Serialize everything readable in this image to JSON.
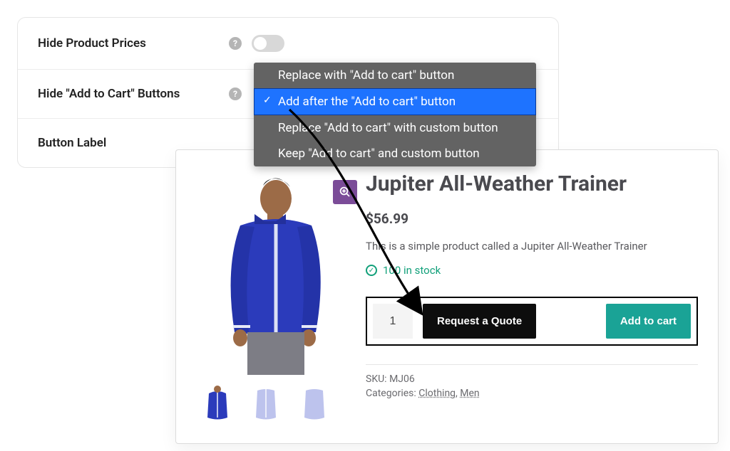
{
  "settings": {
    "row1": {
      "label": "Hide Product Prices"
    },
    "row2": {
      "label": "Hide \"Add to Cart\" Buttons"
    },
    "row3": {
      "label": "Button Label"
    }
  },
  "dropdown": {
    "options": [
      {
        "label": "Replace with \"Add to cart\" button"
      },
      {
        "label": "Add after the \"Add to cart\" button"
      },
      {
        "label": "Replace \"Add to cart\" with custom button"
      },
      {
        "label": "Keep \"Add to cart\" and custom button"
      }
    ]
  },
  "product": {
    "title": "Jupiter All-Weather Trainer",
    "price": "$56.99",
    "description": "This is a simple product called a Jupiter All-Weather Trainer",
    "stock": "100 in stock",
    "qty": "1",
    "quote_btn": "Request a Quote",
    "cart_btn": "Add to cart",
    "sku_label": "SKU:",
    "sku_value": "MJ06",
    "cat_label": "Categories:",
    "cat1": "Clothing",
    "cat_sep": ", ",
    "cat2": "Men"
  }
}
